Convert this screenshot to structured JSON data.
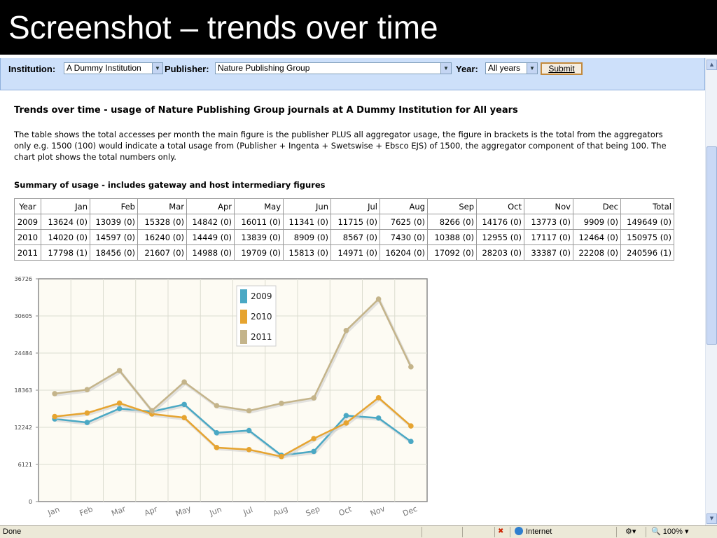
{
  "slide": {
    "title": "Screenshot – trends over time"
  },
  "filters": {
    "institution_label": "Institution:",
    "institution_value": "A Dummy Institution",
    "publisher_label": "Publisher:",
    "publisher_value": "Nature Publishing Group",
    "year_label": "Year:",
    "year_value": "All years",
    "submit_label": "Submit"
  },
  "page": {
    "heading": "Trends over time - usage of Nature Publishing Group journals at A Dummy Institution for All years",
    "description": "The table shows the total accesses per month   the main figure is the publisher PLUS all aggregator usage, the figure in brackets is the total from the aggregators only e.g. 1500 (100) would indicate a total usage from (Publisher + Ingenta + Swetswise + Ebsco EJS) of 1500, the aggregator component of that being 100. The chart plot shows the total numbers only.",
    "summary_heading": "Summary of usage - includes gateway and host intermediary figures"
  },
  "table": {
    "headers": [
      "Year",
      "Jan",
      "Feb",
      "Mar",
      "Apr",
      "May",
      "Jun",
      "Jul",
      "Aug",
      "Sep",
      "Oct",
      "Nov",
      "Dec",
      "Total"
    ],
    "rows": [
      [
        "2009",
        "13624 (0)",
        "13039 (0)",
        "15328 (0)",
        "14842 (0)",
        "16011 (0)",
        "11341 (0)",
        "11715 (0)",
        "7625 (0)",
        "8266 (0)",
        "14176 (0)",
        "13773 (0)",
        "9909 (0)",
        "149649 (0)"
      ],
      [
        "2010",
        "14020 (0)",
        "14597 (0)",
        "16240 (0)",
        "14449 (0)",
        "13839 (0)",
        "8909 (0)",
        "8567 (0)",
        "7430 (0)",
        "10388 (0)",
        "12955 (0)",
        "17117 (0)",
        "12464 (0)",
        "150975 (0)"
      ],
      [
        "2011",
        "17798 (1)",
        "18456 (0)",
        "21607 (0)",
        "14988 (0)",
        "19709 (0)",
        "15813 (0)",
        "14971 (0)",
        "16204 (0)",
        "17092 (0)",
        "28203 (0)",
        "33387 (0)",
        "22208 (0)",
        "240596 (1)"
      ]
    ]
  },
  "chart_data": {
    "type": "line",
    "categories": [
      "Jan",
      "Feb",
      "Mar",
      "Apr",
      "May",
      "Jun",
      "Jul",
      "Aug",
      "Sep",
      "Oct",
      "Nov",
      "Dec"
    ],
    "series": [
      {
        "name": "2009",
        "color": "#4aa8c4",
        "values": [
          13624,
          13039,
          15328,
          14842,
          16011,
          11341,
          11715,
          7625,
          8266,
          14176,
          13773,
          9909
        ]
      },
      {
        "name": "2010",
        "color": "#e6a430",
        "values": [
          14020,
          14597,
          16240,
          14449,
          13839,
          8909,
          8567,
          7430,
          10388,
          12955,
          17117,
          12464
        ]
      },
      {
        "name": "2011",
        "color": "#c4b48a",
        "values": [
          17798,
          18456,
          21607,
          14988,
          19709,
          15813,
          14971,
          16204,
          17092,
          28203,
          33387,
          22208
        ]
      }
    ],
    "yticks": [
      "0",
      "6121",
      "12242",
      "18363",
      "24484",
      "30605",
      "36726"
    ],
    "ylim": [
      0,
      36726
    ],
    "grid": true,
    "legend": "top-center"
  },
  "status": {
    "left": "Done",
    "zone": "Internet",
    "zoom": "100%",
    "colors": {
      "globe": "#2f7fcf",
      "warn": "#cc2200"
    }
  },
  "icons": {
    "dropdown": "chevron-down-icon",
    "scroll_up": "arrow-up-icon",
    "scroll_down": "arrow-down-icon",
    "globe": "globe-icon",
    "zoom": "magnifier-icon"
  }
}
